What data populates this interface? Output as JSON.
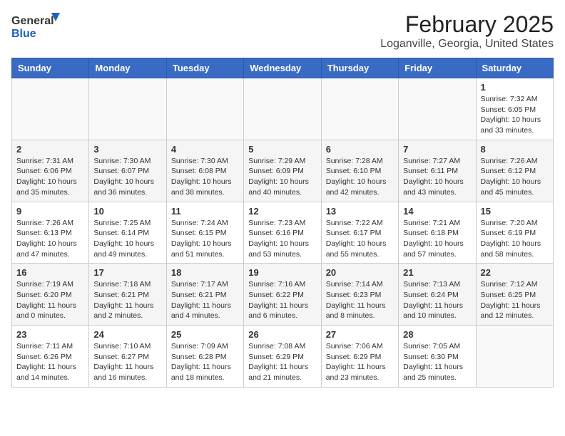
{
  "header": {
    "logo_general": "General",
    "logo_blue": "Blue",
    "title": "February 2025",
    "subtitle": "Loganville, Georgia, United States"
  },
  "days_of_week": [
    "Sunday",
    "Monday",
    "Tuesday",
    "Wednesday",
    "Thursday",
    "Friday",
    "Saturday"
  ],
  "weeks": [
    [
      {
        "day": "",
        "info": ""
      },
      {
        "day": "",
        "info": ""
      },
      {
        "day": "",
        "info": ""
      },
      {
        "day": "",
        "info": ""
      },
      {
        "day": "",
        "info": ""
      },
      {
        "day": "",
        "info": ""
      },
      {
        "day": "1",
        "info": "Sunrise: 7:32 AM\nSunset: 6:05 PM\nDaylight: 10 hours and 33 minutes."
      }
    ],
    [
      {
        "day": "2",
        "info": "Sunrise: 7:31 AM\nSunset: 6:06 PM\nDaylight: 10 hours and 35 minutes."
      },
      {
        "day": "3",
        "info": "Sunrise: 7:30 AM\nSunset: 6:07 PM\nDaylight: 10 hours and 36 minutes."
      },
      {
        "day": "4",
        "info": "Sunrise: 7:30 AM\nSunset: 6:08 PM\nDaylight: 10 hours and 38 minutes."
      },
      {
        "day": "5",
        "info": "Sunrise: 7:29 AM\nSunset: 6:09 PM\nDaylight: 10 hours and 40 minutes."
      },
      {
        "day": "6",
        "info": "Sunrise: 7:28 AM\nSunset: 6:10 PM\nDaylight: 10 hours and 42 minutes."
      },
      {
        "day": "7",
        "info": "Sunrise: 7:27 AM\nSunset: 6:11 PM\nDaylight: 10 hours and 43 minutes."
      },
      {
        "day": "8",
        "info": "Sunrise: 7:26 AM\nSunset: 6:12 PM\nDaylight: 10 hours and 45 minutes."
      }
    ],
    [
      {
        "day": "9",
        "info": "Sunrise: 7:26 AM\nSunset: 6:13 PM\nDaylight: 10 hours and 47 minutes."
      },
      {
        "day": "10",
        "info": "Sunrise: 7:25 AM\nSunset: 6:14 PM\nDaylight: 10 hours and 49 minutes."
      },
      {
        "day": "11",
        "info": "Sunrise: 7:24 AM\nSunset: 6:15 PM\nDaylight: 10 hours and 51 minutes."
      },
      {
        "day": "12",
        "info": "Sunrise: 7:23 AM\nSunset: 6:16 PM\nDaylight: 10 hours and 53 minutes."
      },
      {
        "day": "13",
        "info": "Sunrise: 7:22 AM\nSunset: 6:17 PM\nDaylight: 10 hours and 55 minutes."
      },
      {
        "day": "14",
        "info": "Sunrise: 7:21 AM\nSunset: 6:18 PM\nDaylight: 10 hours and 57 minutes."
      },
      {
        "day": "15",
        "info": "Sunrise: 7:20 AM\nSunset: 6:19 PM\nDaylight: 10 hours and 58 minutes."
      }
    ],
    [
      {
        "day": "16",
        "info": "Sunrise: 7:19 AM\nSunset: 6:20 PM\nDaylight: 11 hours and 0 minutes."
      },
      {
        "day": "17",
        "info": "Sunrise: 7:18 AM\nSunset: 6:21 PM\nDaylight: 11 hours and 2 minutes."
      },
      {
        "day": "18",
        "info": "Sunrise: 7:17 AM\nSunset: 6:21 PM\nDaylight: 11 hours and 4 minutes."
      },
      {
        "day": "19",
        "info": "Sunrise: 7:16 AM\nSunset: 6:22 PM\nDaylight: 11 hours and 6 minutes."
      },
      {
        "day": "20",
        "info": "Sunrise: 7:14 AM\nSunset: 6:23 PM\nDaylight: 11 hours and 8 minutes."
      },
      {
        "day": "21",
        "info": "Sunrise: 7:13 AM\nSunset: 6:24 PM\nDaylight: 11 hours and 10 minutes."
      },
      {
        "day": "22",
        "info": "Sunrise: 7:12 AM\nSunset: 6:25 PM\nDaylight: 11 hours and 12 minutes."
      }
    ],
    [
      {
        "day": "23",
        "info": "Sunrise: 7:11 AM\nSunset: 6:26 PM\nDaylight: 11 hours and 14 minutes."
      },
      {
        "day": "24",
        "info": "Sunrise: 7:10 AM\nSunset: 6:27 PM\nDaylight: 11 hours and 16 minutes."
      },
      {
        "day": "25",
        "info": "Sunrise: 7:09 AM\nSunset: 6:28 PM\nDaylight: 11 hours and 18 minutes."
      },
      {
        "day": "26",
        "info": "Sunrise: 7:08 AM\nSunset: 6:29 PM\nDaylight: 11 hours and 21 minutes."
      },
      {
        "day": "27",
        "info": "Sunrise: 7:06 AM\nSunset: 6:29 PM\nDaylight: 11 hours and 23 minutes."
      },
      {
        "day": "28",
        "info": "Sunrise: 7:05 AM\nSunset: 6:30 PM\nDaylight: 11 hours and 25 minutes."
      },
      {
        "day": "",
        "info": ""
      }
    ]
  ]
}
